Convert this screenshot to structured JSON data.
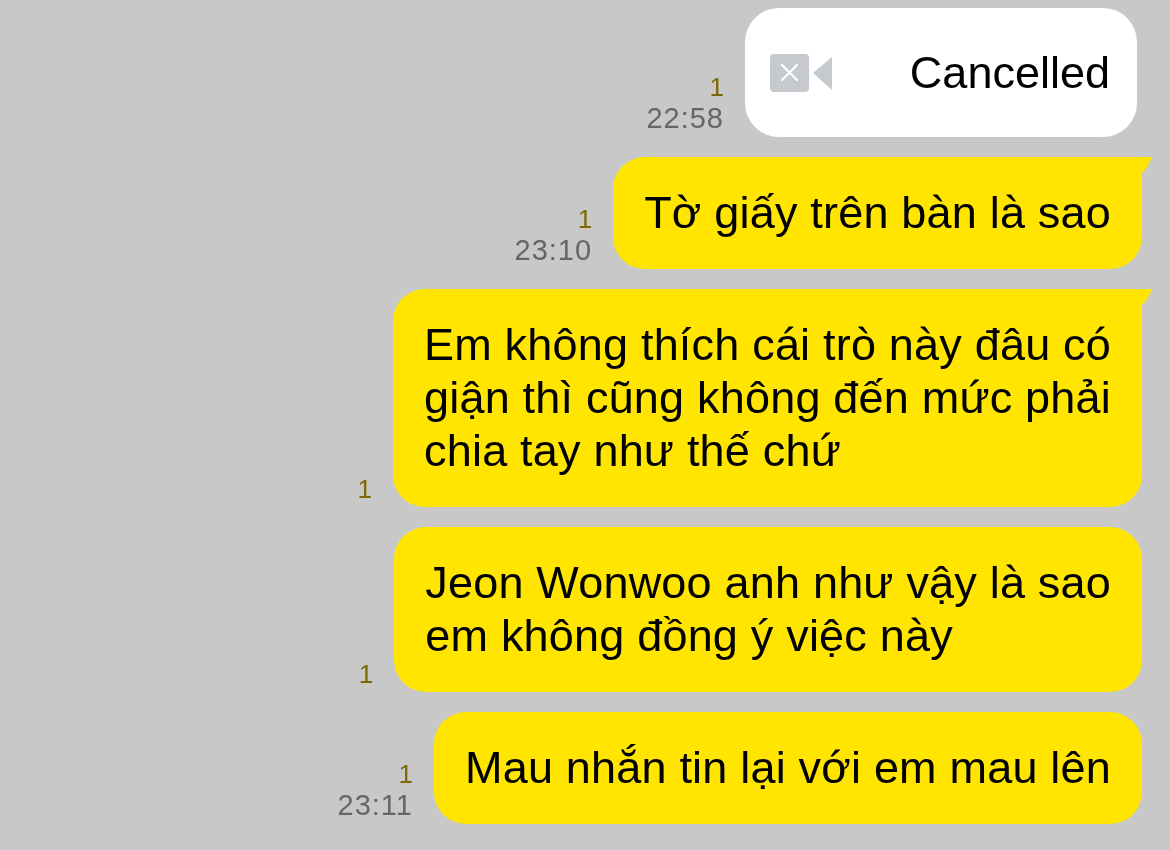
{
  "messages": [
    {
      "kind": "call",
      "text": "Cancelled",
      "unread": "1",
      "time": "22:58",
      "tail": false
    },
    {
      "kind": "text",
      "text": "Tờ giấy trên bàn là sao",
      "unread": "1",
      "time": "23:10",
      "tail": true
    },
    {
      "kind": "text",
      "text": "Em không thích cái trò này đâu có\ngiận thì cũng không đến mức phải\nchia tay như thế chứ",
      "unread": "1",
      "tail": true
    },
    {
      "kind": "text",
      "text": "Jeon Wonwoo anh như vậy là sao\nem không đồng ý việc này",
      "unread": "1",
      "tail": false
    },
    {
      "kind": "text",
      "text": "Mau nhắn tin lại với em mau lên",
      "unread": "1",
      "time": "23:11",
      "tail": false
    }
  ]
}
